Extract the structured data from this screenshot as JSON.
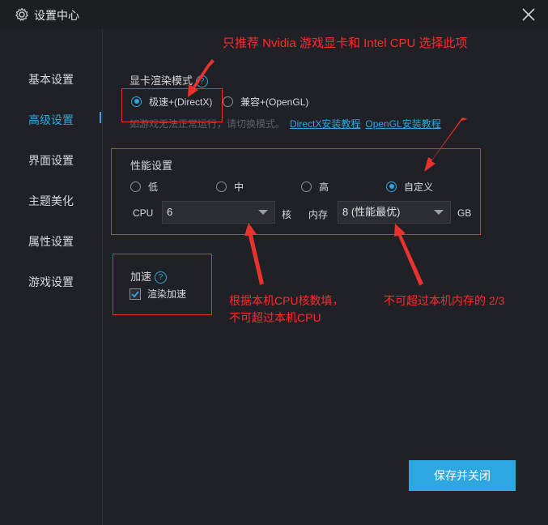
{
  "window": {
    "title": "设置中心"
  },
  "sidebar": {
    "items": [
      {
        "label": "基本设置"
      },
      {
        "label": "高级设置",
        "active": true
      },
      {
        "label": "界面设置"
      },
      {
        "label": "主题美化"
      },
      {
        "label": "属性设置"
      },
      {
        "label": "游戏设置"
      }
    ]
  },
  "render": {
    "title": "显卡渲染模式",
    "options": [
      {
        "label": "极速+(DirectX)",
        "checked": true
      },
      {
        "label": "兼容+(OpenGL)",
        "checked": false
      }
    ],
    "hint": "如游戏无法正常运行，请切换模式。",
    "link_directx": "DirectX安装教程",
    "link_opengl": "OpenGL安装教程"
  },
  "performance": {
    "title": "性能设置",
    "options": [
      {
        "label": "低",
        "checked": false
      },
      {
        "label": "中",
        "checked": false
      },
      {
        "label": "高",
        "checked": false
      },
      {
        "label": "自定义",
        "checked": true
      }
    ],
    "cpu_label": "CPU",
    "cpu_value": "6",
    "cpu_unit": "核",
    "mem_label": "内存",
    "mem_value": "8 (性能最优)",
    "mem_unit": "GB"
  },
  "accel": {
    "title": "加速",
    "checkbox_label": "渲染加速",
    "checked": true
  },
  "buttons": {
    "save": "保存并关闭"
  },
  "annotations": {
    "top": "只推荐 Nvidia 游戏显卡和 Intel CPU 选择此项",
    "cpu_line1": "根据本机CPU核数填，",
    "cpu_line2": "不可超过本机CPU",
    "memory": "不可超过本机内存的 2/3"
  },
  "colors": {
    "accent": "#2ea7e0",
    "annotation": "#ff2a2a",
    "background": "#1f2126"
  },
  "icons": {
    "title": "gear-icon",
    "close": "close-icon",
    "help": "help-icon",
    "caret": "chevron-down-icon",
    "check": "check-icon"
  }
}
